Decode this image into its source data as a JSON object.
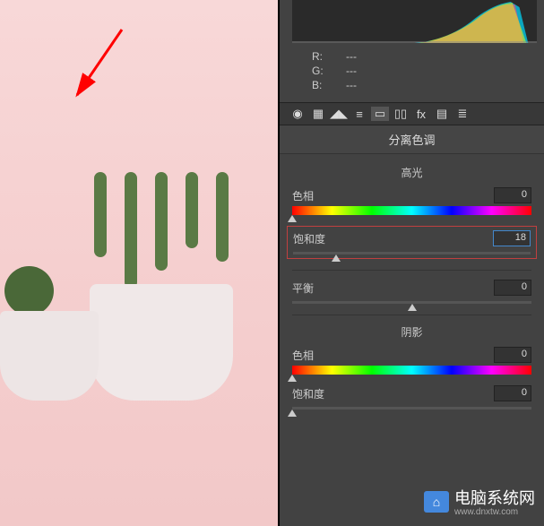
{
  "rgb": {
    "r_label": "R:",
    "g_label": "G:",
    "b_label": "B:",
    "r_value": "---",
    "g_value": "---",
    "b_value": "---"
  },
  "panel": {
    "title": "分离色调"
  },
  "highlights": {
    "section_label": "高光",
    "hue_label": "色相",
    "hue_value": "0",
    "hue_pos": 0,
    "saturation_label": "饱和度",
    "saturation_value": "18",
    "saturation_pos": 18
  },
  "balance": {
    "label": "平衡",
    "value": "0",
    "pos": 50
  },
  "shadows": {
    "section_label": "阴影",
    "hue_label": "色相",
    "hue_value": "0",
    "hue_pos": 0,
    "saturation_label": "饱和度",
    "saturation_value": "0",
    "saturation_pos": 0
  },
  "watermark": {
    "text": "电脑系统网",
    "sub": "www.dnxtw.com"
  }
}
